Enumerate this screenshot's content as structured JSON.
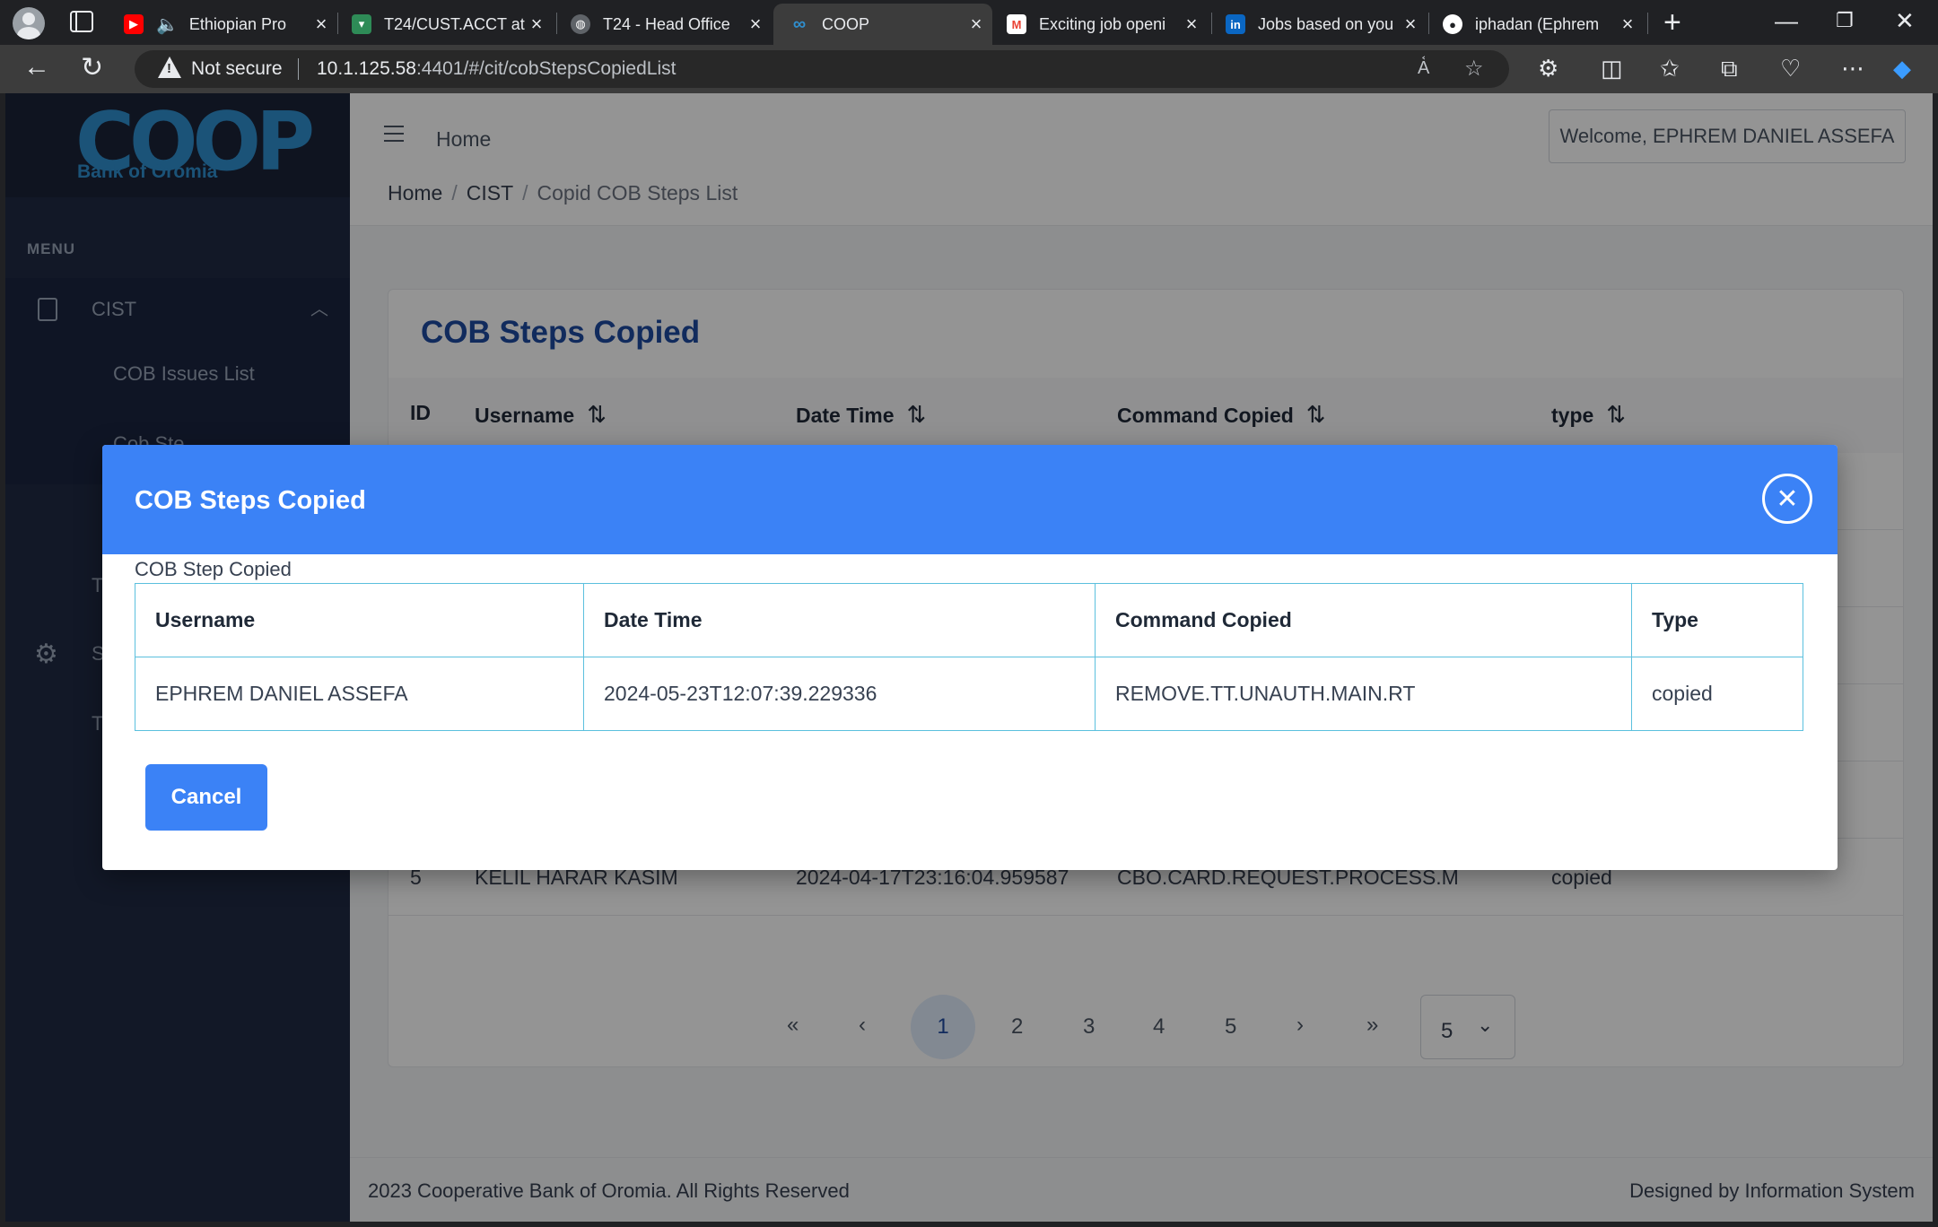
{
  "browser": {
    "tabs": [
      {
        "title": "Ethiopian Pro",
        "favicon": "youtube-icon",
        "color": "#ff0000"
      },
      {
        "title": "T24/CUST.ACCT at",
        "favicon": "t24-icon",
        "color": "#2e8b57"
      },
      {
        "title": "T24 - Head Office",
        "favicon": "globe-icon",
        "color": "#5f6368"
      },
      {
        "title": "COOP",
        "favicon": "coop-icon",
        "color": "#2f8fcf"
      },
      {
        "title": "Exciting job openi",
        "favicon": "gmail-icon",
        "color": "#ea4335"
      },
      {
        "title": "Jobs based on you",
        "favicon": "linkedin-icon",
        "color": "#0a66c2"
      },
      {
        "title": "iphadan (Ephrem",
        "favicon": "github-icon",
        "color": "#ffffff"
      }
    ],
    "active_tab_index": 3,
    "security_text": "Not secure",
    "url_host": "10.1.125.58",
    "url_rest": ":4401/#/cit/cobStepsCopiedList"
  },
  "sidebar": {
    "logo": "COOP",
    "logo_sub": "Bank of Oromia",
    "menu_label": "MENU",
    "group": "CIST",
    "items": [
      "COB Issues List",
      "Cob Ste"
    ],
    "hidden_items": [
      "T",
      "S",
      "T"
    ]
  },
  "topbar": {
    "home": "Home",
    "welcome": "Welcome, EPHREM DANIEL ASSEFA"
  },
  "breadcrumb": {
    "home": "Home",
    "section": "CIST",
    "current": "Copid COB Steps List"
  },
  "list": {
    "title": "COB Steps Copied",
    "columns": [
      "ID",
      "Username",
      "Date Time",
      "Command Copied",
      "type"
    ],
    "last_row": {
      "id": "5",
      "username": "KELIL HARAR KASIM",
      "datetime": "2024-04-17T23:16:04.959587",
      "command": "CBO.CARD.REQUEST.PROCESS.M",
      "type": "copied"
    },
    "pager": {
      "first": "«",
      "prev": "‹",
      "pages": [
        "1",
        "2",
        "3",
        "4",
        "5"
      ],
      "next": "›",
      "last": "»",
      "current": "1",
      "rows_per_page": "5"
    }
  },
  "modal": {
    "title": "COB Steps Copied",
    "subtitle": "COB Step Copied",
    "columns": [
      "Username",
      "Date Time",
      "Command Copied",
      "Type"
    ],
    "row": [
      "EPHREM DANIEL ASSEFA",
      "2024-05-23T12:07:39.229336",
      "REMOVE.TT.UNAUTH.MAIN.RT",
      "copied"
    ],
    "cancel": "Cancel"
  },
  "footer": {
    "left": "2023 Cooperative Bank of Oromia. All Rights Reserved",
    "right": "Designed by Information System"
  },
  "colors": {
    "accent": "#3b82f6",
    "sidebar": "#1f2a44",
    "title_blue": "#1e4aa0",
    "table_border": "#5bc0de"
  }
}
